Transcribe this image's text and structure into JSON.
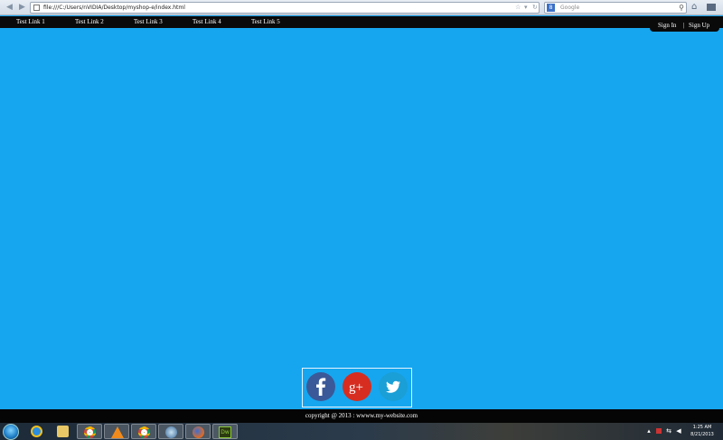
{
  "browser": {
    "url": "file:///C:/Users/nVIDIA/Desktop/myshop-e/index.html",
    "search_placeholder": "Google",
    "search_engine_badge": "8"
  },
  "site": {
    "nav_links": [
      "Test Link 1",
      "Test Link 2",
      "Test Link 3",
      "Test Link 4",
      "Test Link 5"
    ],
    "sign_in": "Sign In",
    "separator": "|",
    "sign_up": "Sign Up",
    "background_color": "#16a6ef",
    "footer_text": "copyright @ 2013 : wwww.my-website.com"
  },
  "social": [
    {
      "name": "facebook",
      "glyph": "f",
      "color": "#3b5998"
    },
    {
      "name": "google-plus",
      "glyph": "g+",
      "color": "#d62d20"
    },
    {
      "name": "twitter",
      "glyph": "bird",
      "color": "#1a9fd6"
    }
  ],
  "taskbar": {
    "apps": [
      "internet-explorer",
      "windows-explorer",
      "chrome",
      "vlc",
      "chrome",
      "network-app",
      "firefox",
      "dreamweaver"
    ],
    "dreamweaver_label": "Dw",
    "time": "1:25 AM",
    "date": "8/21/2013"
  }
}
